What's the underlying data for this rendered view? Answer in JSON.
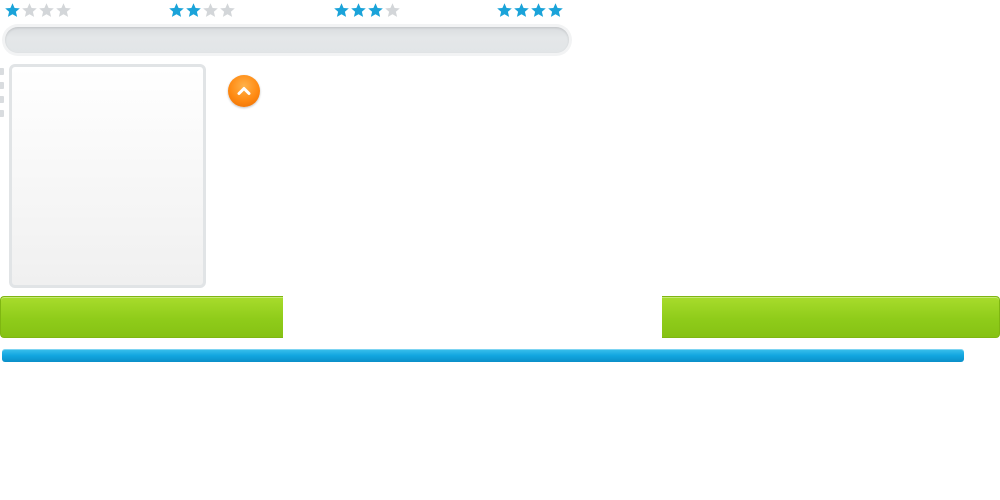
{
  "ratings": [
    {
      "value": 1,
      "max": 4
    },
    {
      "value": 2,
      "max": 4
    },
    {
      "value": 3,
      "max": 4
    },
    {
      "value": 4,
      "max": 4
    }
  ],
  "progress": {
    "value": 1.0
  },
  "colors": {
    "star_filled": "#1aa3d9",
    "star_empty": "#d3d6d9",
    "accent_green": "#8fcc1a",
    "accent_orange": "#ff8a12",
    "accent_blue": "#12a6e0"
  },
  "icons": {
    "scroll_top": "chevron-up-icon",
    "rating_star": "star-icon"
  }
}
